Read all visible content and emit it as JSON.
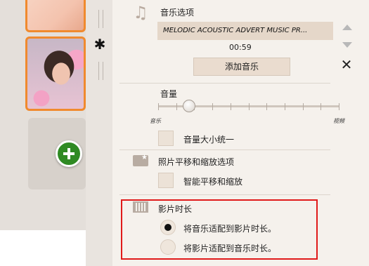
{
  "music": {
    "section_label": "音乐选项",
    "track_name": "MELODIC ACOUSTIC ADVERT MUSIC PR...",
    "duration": "00:59",
    "add_music_label": "添加音乐",
    "move_up_icon": "arrow-up-icon",
    "move_down_icon": "arrow-down-icon",
    "remove_icon": "close-icon"
  },
  "volume": {
    "label": "音量",
    "left_label": "音乐",
    "right_label": "视频",
    "value_fraction": 0.17,
    "tick_count": 11
  },
  "normalize": {
    "label": "音量大小统一",
    "checked": false
  },
  "pan_zoom": {
    "section_label": "照片平移和缩放选项",
    "smart_label": "智能平移和缩放",
    "checked": false
  },
  "duration_options": {
    "section_label": "影片时长",
    "options": [
      {
        "label": "将音乐适配到影片时长。",
        "selected": true
      },
      {
        "label": "将影片适配到音乐时长。",
        "selected": false
      }
    ]
  },
  "colors": {
    "accent_orange": "#f08a2e",
    "add_button_green": "#2f8a23",
    "highlight_red": "#e01a1a",
    "panel_bg": "#f5f1ec"
  },
  "icons": [
    "music-note-icon",
    "gear-icon",
    "plus-icon",
    "photo-icon",
    "film-icon"
  ]
}
